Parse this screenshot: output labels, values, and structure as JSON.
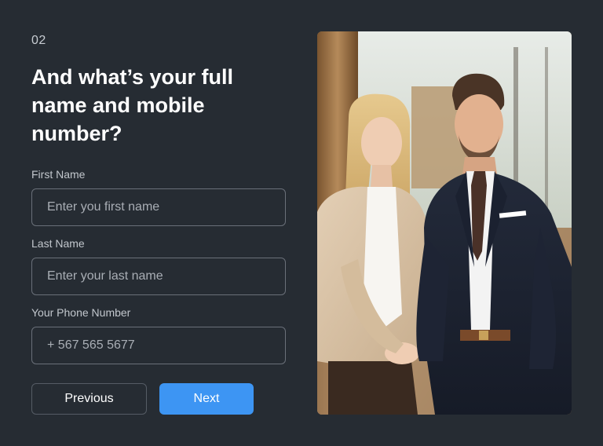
{
  "step": {
    "number": "02"
  },
  "heading": "And what’s your full\nname and mobile\nnumber?",
  "fields": {
    "first_name": {
      "label": "First Name",
      "placeholder": "Enter you first name",
      "value": ""
    },
    "last_name": {
      "label": "Last Name",
      "placeholder": "Enter your last name",
      "value": ""
    },
    "phone": {
      "label": "Your Phone Number",
      "placeholder": "+ 567 565 5677",
      "value": ""
    }
  },
  "buttons": {
    "previous_label": "Previous",
    "next_label": "Next"
  },
  "colors": {
    "background": "#262c33",
    "accent": "#3d95f3",
    "input_border": "#6a7079",
    "placeholder": "#a9aeb5"
  },
  "image": {
    "subject": "business-people-photo"
  }
}
